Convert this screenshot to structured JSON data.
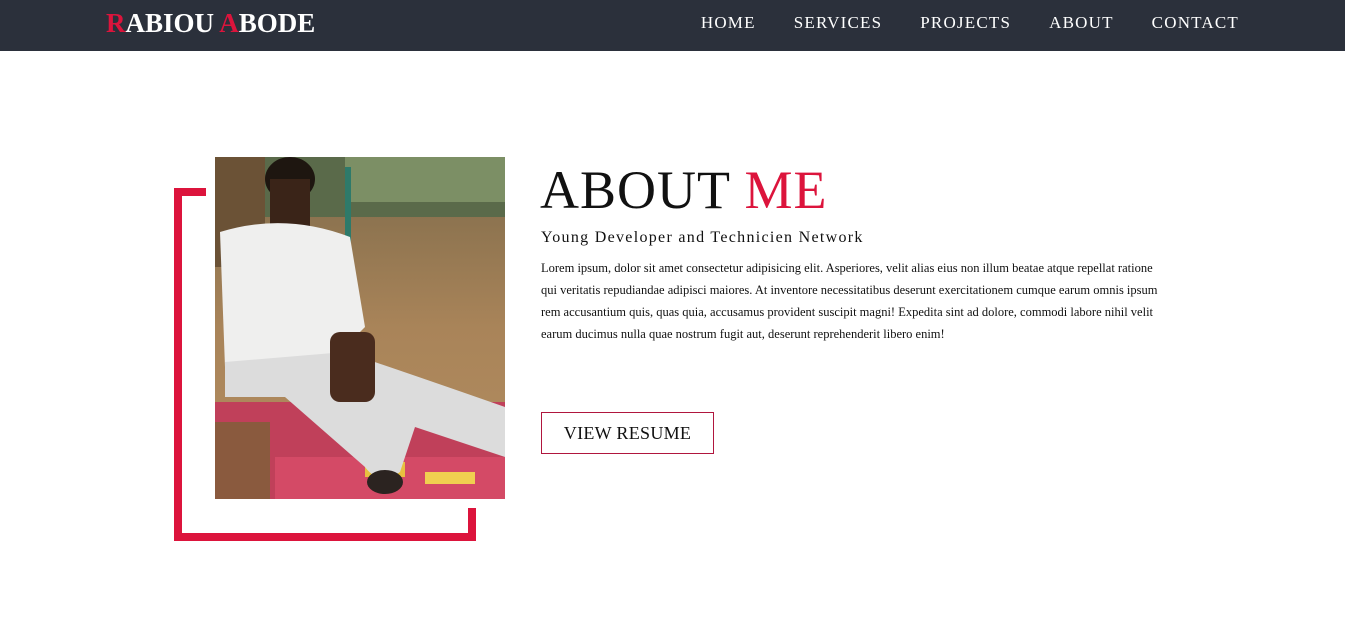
{
  "brand": {
    "first_initial": "R",
    "first_rest": "ABIOU",
    "last_initial": "A",
    "last_rest": "BODE",
    "accent_color": "#dc143c"
  },
  "nav": {
    "items": [
      {
        "label": "HOME"
      },
      {
        "label": "SERVICES"
      },
      {
        "label": "PROJECTS"
      },
      {
        "label": "ABOUT"
      },
      {
        "label": "CONTACT"
      }
    ]
  },
  "about": {
    "title_main": "ABOUT",
    "title_accent": "ME",
    "subtitle": "Young Developer and Technicien Network",
    "bio": "Lorem ipsum, dolor sit amet consectetur adipisicing elit. Asperiores, velit alias eius non illum beatae atque repellat ratione qui veritatis repudiandae adipisci maiores. At inventore necessitatibus deserunt exercitationem cumque earum omnis ipsum rem accusantium quis, quas quia, accusamus provident suscipit magni! Expedita sint ad dolore, commodi labore nihil velit earum ducimus nulla quae nostrum fugit aut, deserunt reprehenderit libero enim!",
    "button_label": "VIEW RESUME"
  },
  "colors": {
    "navbar_bg": "#2b303b",
    "accent": "#dc143c"
  }
}
